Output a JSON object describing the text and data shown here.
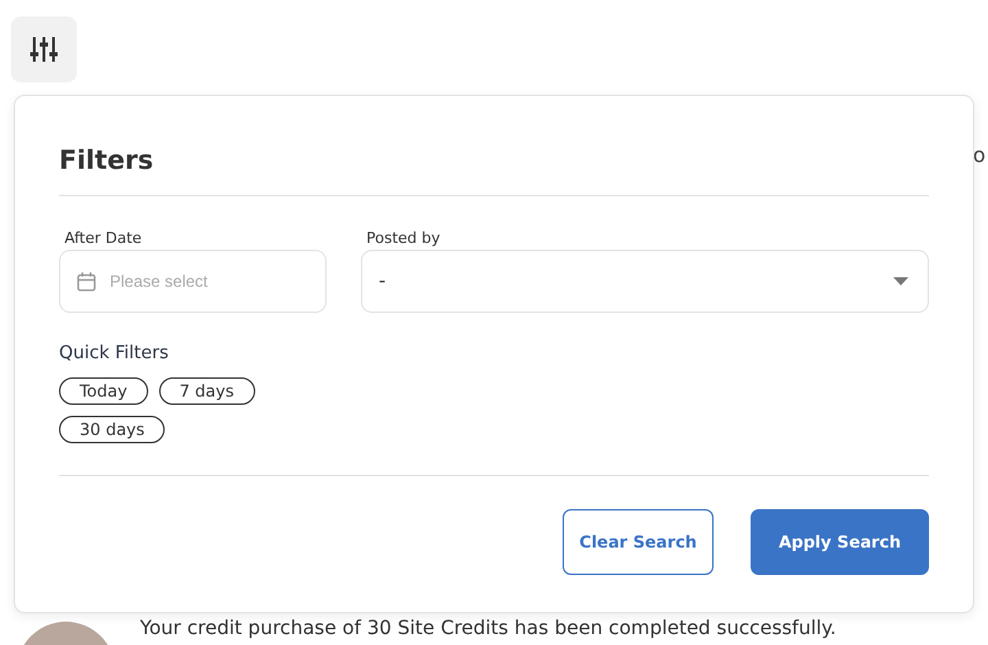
{
  "background": {
    "fragment": "o",
    "notification": "Your credit purchase of 30 Site Credits has been completed successfully."
  },
  "filters_panel": {
    "title": "Filters",
    "fields": [
      {
        "kind": "date",
        "label": "After Date",
        "placeholder": "Please select"
      },
      {
        "kind": "select",
        "label": "Posted by",
        "value": "-"
      }
    ],
    "quick_filters_title": "Quick Filters",
    "quick_filters": [
      {
        "label": "Today",
        "selected": false
      },
      {
        "label": "7 days",
        "selected": false
      },
      {
        "label": "30 days",
        "selected": false
      }
    ],
    "buttons": [
      {
        "kind": "outline",
        "label": "Clear Search"
      },
      {
        "kind": "primary",
        "label": "Apply Search"
      }
    ]
  }
}
